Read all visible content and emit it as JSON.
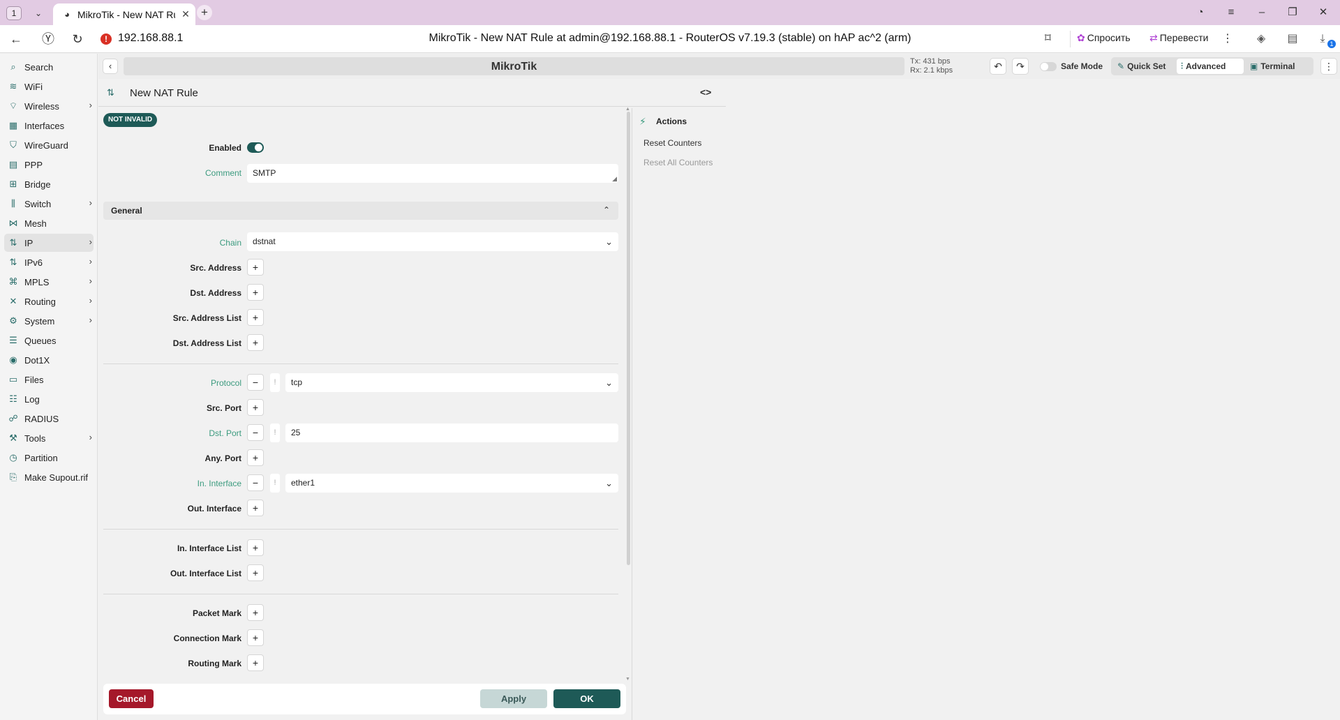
{
  "browser": {
    "tab_counter": "1",
    "tab_title": "MikroTik - New NAT Rule",
    "url": "192.168.88.1",
    "page_title": "MikroTik - New NAT Rule at admin@192.168.88.1 - RouterOS v7.19.3 (stable) on hAP ac^2 (arm)",
    "ask_label": "Спросить",
    "translate_label": "Перевести",
    "download_count": "1"
  },
  "topbar": {
    "brand": "MikroTik",
    "tx": "Tx: 431 bps",
    "rx": "Rx: 2.1 kbps",
    "safe_mode": "Safe Mode",
    "quick_set": "Quick Set",
    "advanced": "Advanced",
    "terminal": "Terminal"
  },
  "sidebar": {
    "items": [
      {
        "label": "Search",
        "icon": "search-icon",
        "chevron": false
      },
      {
        "label": "WiFi",
        "icon": "wifi-icon",
        "chevron": false
      },
      {
        "label": "Wireless",
        "icon": "wireless-icon",
        "chevron": true
      },
      {
        "label": "Interfaces",
        "icon": "interfaces-icon",
        "chevron": false
      },
      {
        "label": "WireGuard",
        "icon": "shield-icon",
        "chevron": false
      },
      {
        "label": "PPP",
        "icon": "ppp-icon",
        "chevron": false
      },
      {
        "label": "Bridge",
        "icon": "bridge-icon",
        "chevron": false
      },
      {
        "label": "Switch",
        "icon": "switch-icon",
        "chevron": true
      },
      {
        "label": "Mesh",
        "icon": "mesh-icon",
        "chevron": false
      },
      {
        "label": "IP",
        "icon": "ip-icon",
        "chevron": true,
        "active": true
      },
      {
        "label": "IPv6",
        "icon": "ipv6-icon",
        "chevron": true
      },
      {
        "label": "MPLS",
        "icon": "tag-icon",
        "chevron": true
      },
      {
        "label": "Routing",
        "icon": "routing-icon",
        "chevron": true
      },
      {
        "label": "System",
        "icon": "gear-icon",
        "chevron": true
      },
      {
        "label": "Queues",
        "icon": "queues-icon",
        "chevron": false
      },
      {
        "label": "Dot1X",
        "icon": "dot1x-icon",
        "chevron": false
      },
      {
        "label": "Files",
        "icon": "folder-icon",
        "chevron": false
      },
      {
        "label": "Log",
        "icon": "log-icon",
        "chevron": false
      },
      {
        "label": "RADIUS",
        "icon": "radius-icon",
        "chevron": false
      },
      {
        "label": "Tools",
        "icon": "tools-icon",
        "chevron": true
      },
      {
        "label": "Partition",
        "icon": "partition-icon",
        "chevron": false
      },
      {
        "label": "Make Supout.rif",
        "icon": "supout-icon",
        "chevron": false
      }
    ]
  },
  "form": {
    "title": "New NAT Rule",
    "badge": "NOT INVALID",
    "enabled_label": "Enabled",
    "comment_label": "Comment",
    "comment_value": "SMTP",
    "section_general": "General",
    "chain_label": "Chain",
    "chain_value": "dstnat",
    "src_address": "Src. Address",
    "dst_address": "Dst. Address",
    "src_address_list": "Src. Address List",
    "dst_address_list": "Dst. Address List",
    "protocol_label": "Protocol",
    "protocol_value": "tcp",
    "src_port": "Src. Port",
    "dst_port_label": "Dst. Port",
    "dst_port_value": "25",
    "any_port": "Any. Port",
    "in_interface_label": "In. Interface",
    "in_interface_value": "ether1",
    "out_interface": "Out. Interface",
    "in_interface_list": "In. Interface List",
    "out_interface_list": "Out. Interface List",
    "packet_mark": "Packet Mark",
    "connection_mark": "Connection Mark",
    "routing_mark": "Routing Mark",
    "plus": "+",
    "minus": "−",
    "neg": "!"
  },
  "footer": {
    "cancel": "Cancel",
    "apply": "Apply",
    "ok": "OK"
  },
  "actions": {
    "title": "Actions",
    "reset_counters": "Reset Counters",
    "reset_all_counters": "Reset All Counters"
  },
  "colors": {
    "accent": "#1e5a57",
    "label_teal": "#3c9b7f",
    "cancel_red": "#a5182a"
  }
}
